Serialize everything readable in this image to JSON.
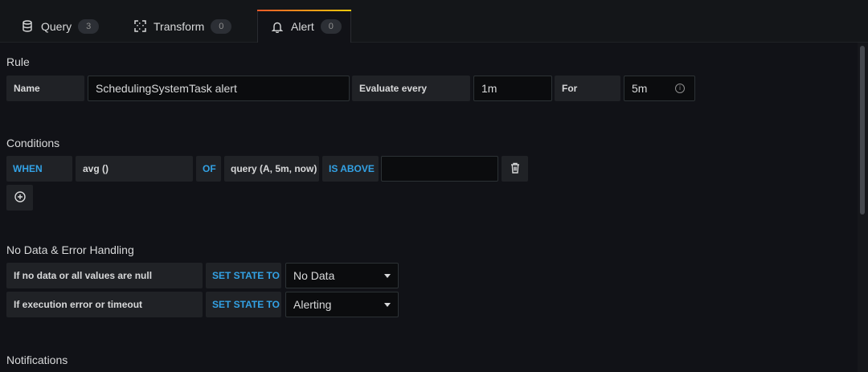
{
  "tabs": [
    {
      "label": "Query",
      "count": "3",
      "icon": "database-icon"
    },
    {
      "label": "Transform",
      "count": "0",
      "icon": "transform-icon"
    },
    {
      "label": "Alert",
      "count": "0",
      "icon": "bell-icon",
      "active": true
    }
  ],
  "colors": {
    "accent_blue": "#33a2e5",
    "tab_gradient_start": "#f05a28",
    "tab_gradient_end": "#fbca0a",
    "background": "#111217"
  },
  "rule": {
    "title": "Rule",
    "name_label": "Name",
    "name_value": "SchedulingSystemTask alert",
    "evaluate_label": "Evaluate every",
    "evaluate_value": "1m",
    "for_label": "For",
    "for_value": "5m"
  },
  "conditions": {
    "title": "Conditions",
    "when": "WHEN",
    "reducer": "avg ()",
    "of": "OF",
    "query": "query (A, 5m, now)",
    "evaluator": "IS ABOVE",
    "threshold": ""
  },
  "no_data": {
    "title": "No Data & Error Handling",
    "rows": [
      {
        "label": "If no data or all values are null",
        "set_state": "SET STATE TO",
        "value": "No Data"
      },
      {
        "label": "If execution error or timeout",
        "set_state": "SET STATE TO",
        "value": "Alerting"
      }
    ]
  },
  "notifications": {
    "title": "Notifications"
  }
}
